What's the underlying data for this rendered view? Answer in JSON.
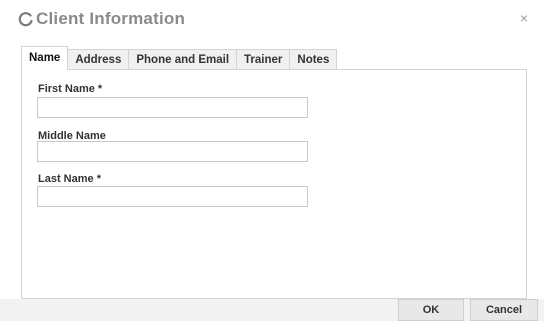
{
  "window": {
    "title": "Client Information",
    "close_glyph": "×",
    "title_icon": "refresh-icon"
  },
  "tabs": [
    {
      "label": "Name",
      "active": true
    },
    {
      "label": "Address",
      "active": false
    },
    {
      "label": "Phone and Email",
      "active": false
    },
    {
      "label": "Trainer",
      "active": false
    },
    {
      "label": "Notes",
      "active": false
    }
  ],
  "form": {
    "first_name": {
      "label": "First Name *",
      "value": ""
    },
    "middle_name": {
      "label": "Middle Name",
      "value": ""
    },
    "last_name": {
      "label": "Last Name *",
      "value": ""
    }
  },
  "buttons": {
    "ok": "OK",
    "cancel": "Cancel"
  }
}
